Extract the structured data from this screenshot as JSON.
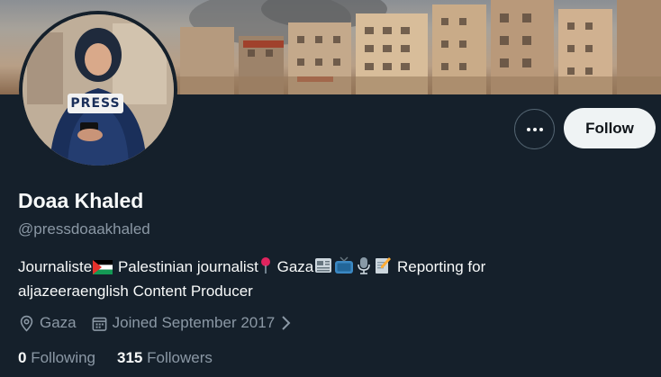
{
  "profile": {
    "name": "Doaa Khaled",
    "handle": "@pressdoaakhaled",
    "bio_part1": "Journaliste",
    "bio_part2": " Palestinian journalist",
    "bio_part3": " Gaza",
    "bio_part4": " Reporting for",
    "bio_line2": "aljazeeraenglish Content Producer",
    "location": "Gaza",
    "joined": "Joined September 2017",
    "avatar_vest_text": "PRESS"
  },
  "actions": {
    "follow_label": "Follow"
  },
  "stats": {
    "following_count": "0",
    "following_label": "Following",
    "followers_count": "315",
    "followers_label": "Followers"
  },
  "icons": [
    "palestine-flag-icon",
    "pin-icon",
    "newspaper-icon",
    "tv-icon",
    "microphone-icon",
    "memo-icon",
    "location-icon",
    "calendar-icon",
    "chevron-right-icon",
    "more-icon"
  ],
  "colors": {
    "background": "#15202b",
    "text_primary": "#f7f9f9",
    "text_secondary": "#8b98a5",
    "follow_bg": "#eff3f4",
    "border": "#536471"
  }
}
